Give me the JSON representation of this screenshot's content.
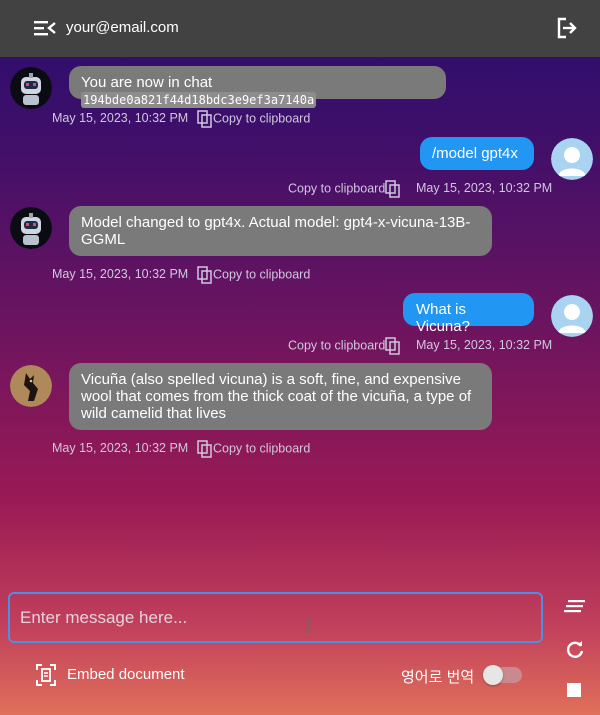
{
  "header": {
    "email": "your@email.com",
    "menu_icon": "menu-collapse-icon",
    "logout_icon": "logout-icon"
  },
  "messages": [
    {
      "role": "bot",
      "text": "You are now in chat ",
      "code": "194bde0a821f44d18bdc3e9ef3a7140a",
      "time": "May 15, 2023, 10:32 PM",
      "copy": "Copy to clipboard"
    },
    {
      "role": "user",
      "text": "/model gpt4x",
      "time": "May 15, 2023, 10:32 PM",
      "copy": "Copy to clipboard"
    },
    {
      "role": "bot",
      "text": "Model changed to gpt4x. Actual model: gpt4-x-vicuna-13B-GGML",
      "time": "May 15, 2023, 10:32 PM",
      "copy": "Copy to clipboard"
    },
    {
      "role": "user",
      "text": "What is Vicuna?",
      "time": "May 15, 2023, 10:32 PM",
      "copy": "Copy to clipboard"
    },
    {
      "role": "bot",
      "text": "Vicuña (also spelled vicuna) is a soft, fine, and expensive wool that comes from the thick coat of the vicuña, a type of wild camelid that lives",
      "time": "May 15, 2023, 10:32 PM",
      "copy": "Copy to clipboard"
    }
  ],
  "input": {
    "placeholder": "Enter message here..."
  },
  "footer": {
    "embed_label": "Embed document",
    "translate_label": "영어로 번역",
    "translate_on": false
  },
  "colors": {
    "topbar": "#424242",
    "bot_bubble": "#7a7a7a",
    "user_bubble": "#2196f3",
    "input_border": "#4d8fe6"
  }
}
